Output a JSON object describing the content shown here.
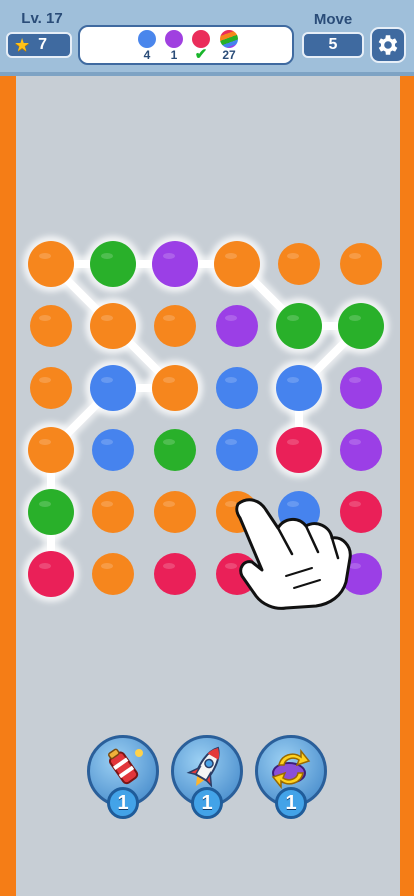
{
  "header": {
    "level_label": "Lv. 17",
    "stars": "7",
    "move_label": "Move",
    "moves": "5"
  },
  "goals": [
    {
      "color": "#4a86ec",
      "count": "4",
      "done": false
    },
    {
      "color": "#a040e0",
      "count": "1",
      "done": false
    },
    {
      "color": "#ea2d5a",
      "count": "",
      "done": true
    },
    {
      "color": "rainbow",
      "count": "27",
      "done": false
    }
  ],
  "colors": {
    "orange": "#f6861d",
    "green": "#29b02a",
    "purple": "#9b3fe6",
    "blue": "#4683ee",
    "red": "#ea2058"
  },
  "grid": [
    [
      "orange",
      "green",
      "purple",
      "orange",
      "orange",
      "orange"
    ],
    [
      "orange",
      "orange",
      "orange",
      "purple",
      "green",
      "green"
    ],
    [
      "orange",
      "blue",
      "orange",
      "blue",
      "blue",
      "purple"
    ],
    [
      "orange",
      "blue",
      "green",
      "blue",
      "red",
      "purple"
    ],
    [
      "green",
      "orange",
      "orange",
      "orange",
      "blue",
      "red"
    ],
    [
      "red",
      "orange",
      "red",
      "red",
      "purple",
      "purple"
    ]
  ],
  "path": [
    [
      0,
      5
    ],
    [
      0,
      4
    ],
    [
      0,
      3
    ],
    [
      1,
      2
    ],
    [
      2,
      2
    ],
    [
      1,
      1
    ],
    [
      0,
      0
    ],
    [
      1,
      0
    ],
    [
      2,
      0
    ],
    [
      3,
      0
    ],
    [
      4,
      1
    ],
    [
      5,
      1
    ],
    [
      4,
      2
    ],
    [
      4,
      3
    ]
  ],
  "boosters": [
    {
      "name": "firecracker",
      "count": "1"
    },
    {
      "name": "rocket",
      "count": "1"
    },
    {
      "name": "shuffle",
      "count": "1"
    }
  ]
}
